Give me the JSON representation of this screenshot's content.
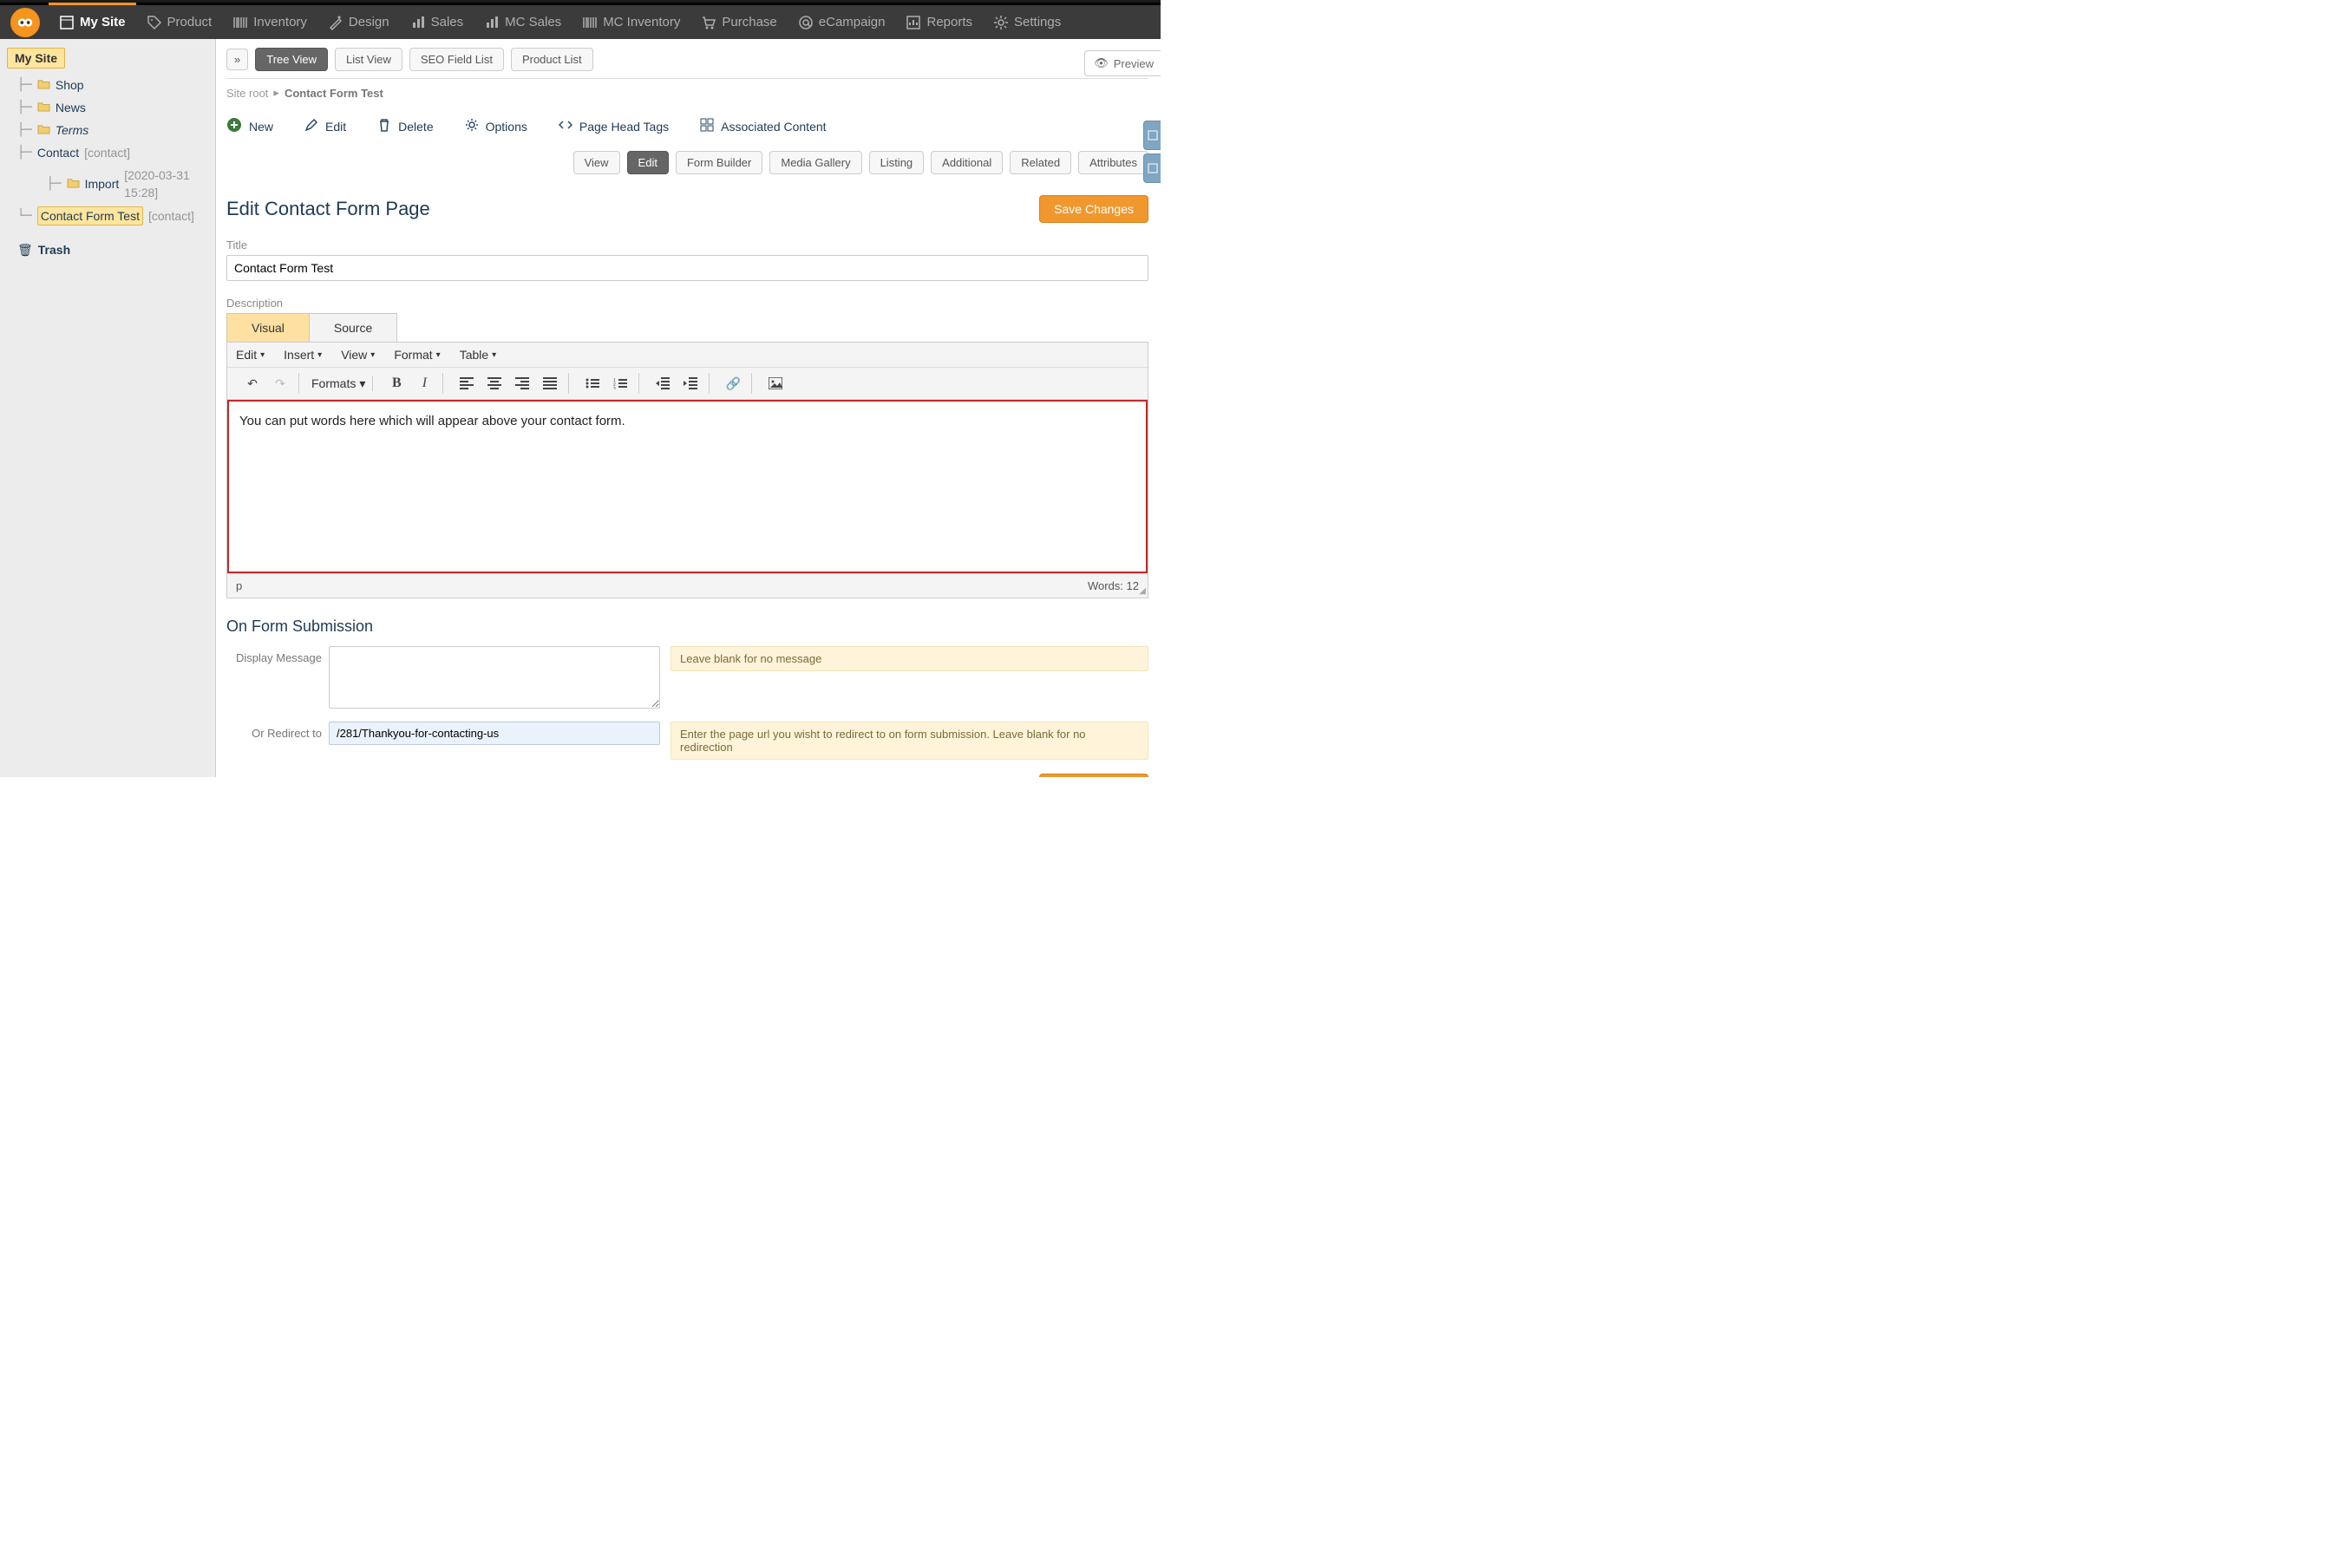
{
  "top_nav": {
    "items": [
      {
        "label": "My Site",
        "active": true,
        "icon": "site"
      },
      {
        "label": "Product",
        "active": false,
        "icon": "tag"
      },
      {
        "label": "Inventory",
        "active": false,
        "icon": "barcode"
      },
      {
        "label": "Design",
        "active": false,
        "icon": "design"
      },
      {
        "label": "Sales",
        "active": false,
        "icon": "bars"
      },
      {
        "label": "MC Sales",
        "active": false,
        "icon": "bars"
      },
      {
        "label": "MC Inventory",
        "active": false,
        "icon": "barcode"
      },
      {
        "label": "Purchase",
        "active": false,
        "icon": "cart"
      },
      {
        "label": "eCampaign",
        "active": false,
        "icon": "at"
      },
      {
        "label": "Reports",
        "active": false,
        "icon": "chart"
      },
      {
        "label": "Settings",
        "active": false,
        "icon": "gear"
      }
    ]
  },
  "sidebar": {
    "heading": "My Site",
    "tree": [
      {
        "label": "Shop",
        "folder": true
      },
      {
        "label": "News",
        "folder": true
      },
      {
        "label": "Terms",
        "folder": true,
        "italic": true
      },
      {
        "label": "Contact",
        "folder": false,
        "suffix": "[contact]"
      },
      {
        "label": "Import",
        "folder": true,
        "suffix": "[2020-03-31 15:28]"
      },
      {
        "label": "Contact Form Test",
        "folder": false,
        "suffix": "[contact]",
        "selected": true
      }
    ],
    "trash_label": "Trash"
  },
  "view_toolbar": {
    "expand_icon": "»",
    "buttons": [
      {
        "label": "Tree View",
        "active": true
      },
      {
        "label": "List View",
        "active": false
      },
      {
        "label": "SEO Field List",
        "active": false
      },
      {
        "label": "Product List",
        "active": false
      }
    ],
    "preview_label": "Preview"
  },
  "breadcrumb": {
    "root": "Site root",
    "current": "Contact Form Test"
  },
  "page_actions": [
    {
      "label": "New",
      "icon": "plus"
    },
    {
      "label": "Edit",
      "icon": "pencil"
    },
    {
      "label": "Delete",
      "icon": "trash"
    },
    {
      "label": "Options",
      "icon": "gear"
    },
    {
      "label": "Page Head Tags",
      "icon": "code"
    },
    {
      "label": "Associated Content",
      "icon": "grid"
    }
  ],
  "sub_tabs": [
    {
      "label": "View",
      "active": false
    },
    {
      "label": "Edit",
      "active": true
    },
    {
      "label": "Form Builder",
      "active": false
    },
    {
      "label": "Media Gallery",
      "active": false
    },
    {
      "label": "Listing",
      "active": false
    },
    {
      "label": "Additional",
      "active": false
    },
    {
      "label": "Related",
      "active": false
    },
    {
      "label": "Attributes",
      "active": false
    }
  ],
  "editor": {
    "heading": "Edit Contact Form Page",
    "save_label": "Save Changes",
    "title_label": "Title",
    "title_value": "Contact Form Test",
    "description_label": "Description",
    "tabs": {
      "visual": "Visual",
      "source": "Source"
    },
    "menubar": [
      "Edit",
      "Insert",
      "View",
      "Format",
      "Table"
    ],
    "formats_label": "Formats",
    "body_text": "You can put words here which will appear above your contact form.",
    "status_path": "p",
    "word_count": "Words: 12"
  },
  "form_submission": {
    "heading": "On Form Submission",
    "display_message_label": "Display Message",
    "display_message_value": "",
    "display_message_hint": "Leave blank for no message",
    "redirect_label": "Or Redirect to",
    "redirect_value": "/281/Thankyou-for-contacting-us",
    "redirect_hint": "Enter the page url you wisht to redirect to on form submission. Leave blank for no redirection"
  }
}
